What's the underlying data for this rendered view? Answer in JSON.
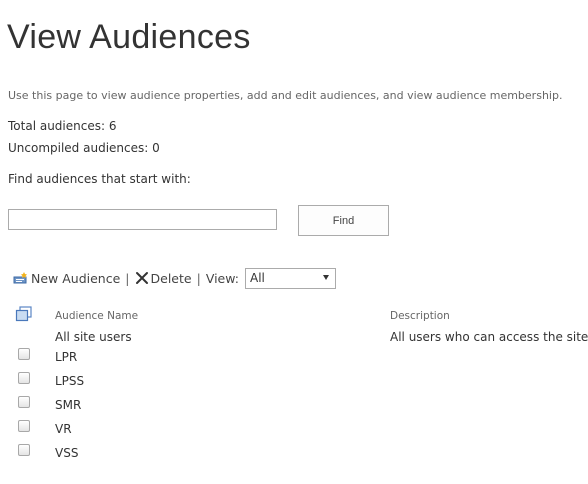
{
  "page": {
    "title": "View Audiences",
    "description": "Use this page to view audience properties, add and edit audiences, and view audience membership."
  },
  "stats": {
    "total": "Total audiences: 6",
    "uncompiled": "Uncompiled audiences: 0"
  },
  "search": {
    "label": "Find audiences that start with:",
    "value": "",
    "button_label": "Find"
  },
  "toolbar": {
    "new_label": "New Audience",
    "delete_label": "Delete",
    "separator": "|",
    "view_label": "View:",
    "view_selected": "All",
    "new_icon": "new-audience-icon",
    "delete_icon": "close-x-icon"
  },
  "table": {
    "select_all_icon": "select-all-icon",
    "columns": [
      "Audience Name",
      "Description"
    ],
    "rows": [
      {
        "name": "All site users",
        "description": "All users who can access the site",
        "checkbox": false
      },
      {
        "name": "LPR",
        "description": "",
        "checkbox": true
      },
      {
        "name": "LPSS",
        "description": "",
        "checkbox": true
      },
      {
        "name": "SMR",
        "description": "",
        "checkbox": true
      },
      {
        "name": "VR",
        "description": "",
        "checkbox": true
      },
      {
        "name": "VSS",
        "description": "",
        "checkbox": true
      }
    ]
  }
}
